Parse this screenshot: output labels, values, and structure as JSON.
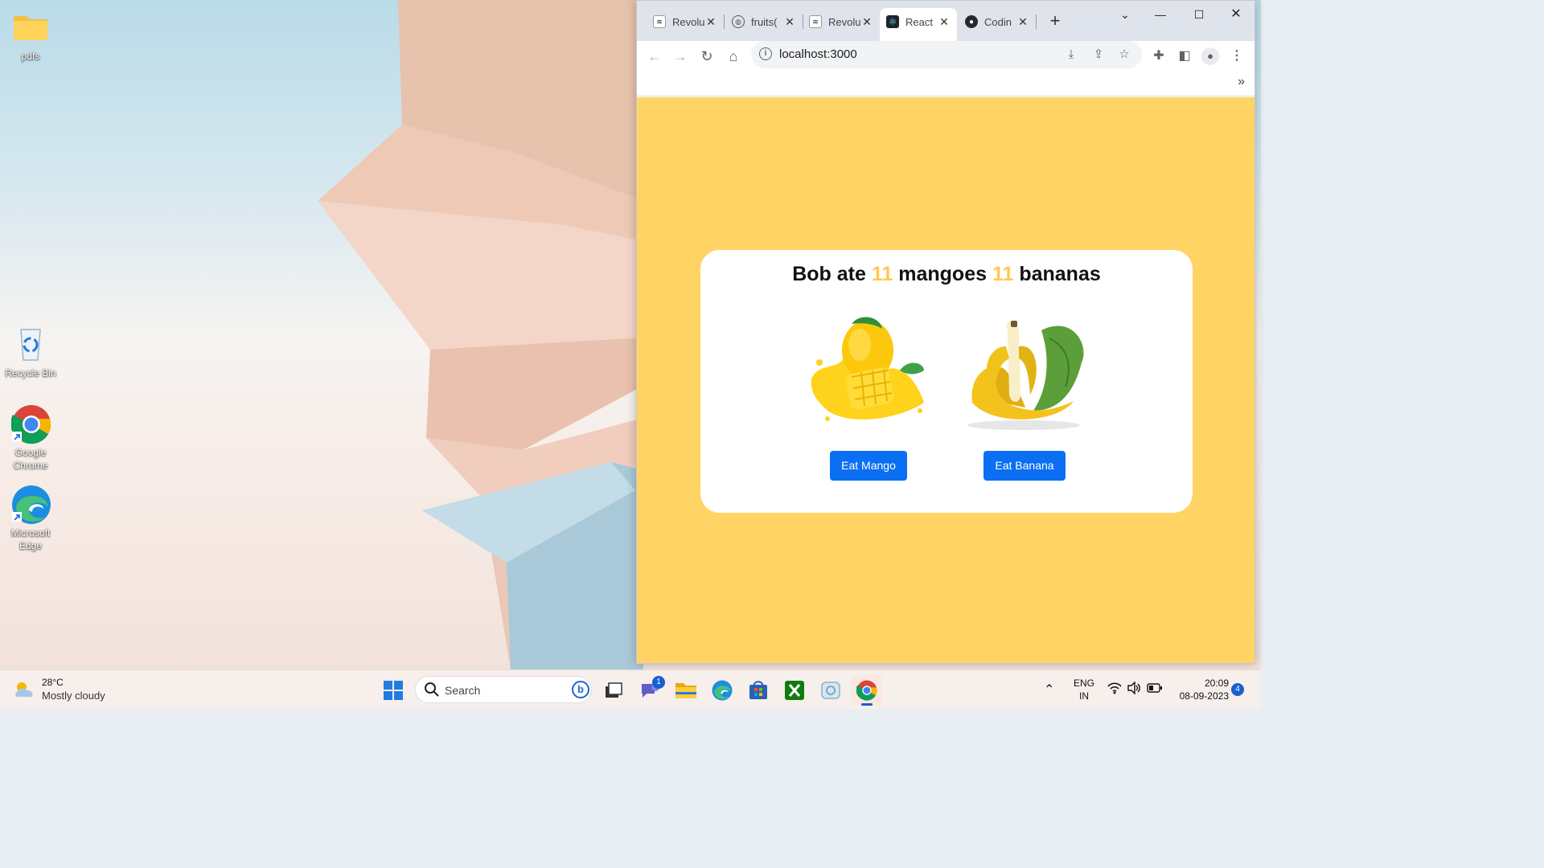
{
  "desktop": {
    "icons": [
      {
        "label": "pdfs",
        "icon": "folder-icon"
      },
      {
        "label": "Recycle Bin",
        "icon": "recycle-bin-icon"
      },
      {
        "label": "Google Chrome",
        "icon": "chrome-icon"
      },
      {
        "label": "Microsoft Edge",
        "icon": "edge-icon"
      }
    ]
  },
  "browser": {
    "tabs": [
      {
        "title": "Revolu",
        "icon": "nxt-wave-icon",
        "active": false
      },
      {
        "title": "fruits(",
        "icon": "globe-icon",
        "active": false
      },
      {
        "title": "Revolu",
        "icon": "nxt-wave-icon",
        "active": false
      },
      {
        "title": "React",
        "icon": "react-icon",
        "active": true
      },
      {
        "title": "Codin",
        "icon": "github-icon",
        "active": false
      }
    ],
    "address": "localhost:3000",
    "overflow_chevron": "»"
  },
  "app": {
    "headline": {
      "prefix": "Bob ate ",
      "mango_count": "11",
      "mid": " mangoes ",
      "banana_count": "11",
      "suffix": " bananas"
    },
    "buttons": {
      "eat_mango": "Eat Mango",
      "eat_banana": "Eat Banana"
    },
    "colors": {
      "background": "#ffd465",
      "accent_number": "#ffc94d",
      "button": "#0a6ff2"
    }
  },
  "taskbar": {
    "weather": {
      "temp": "28°C",
      "condition": "Mostly cloudy"
    },
    "search_placeholder": "Search",
    "teams_badge": "1",
    "language": {
      "line1": "ENG",
      "line2": "IN"
    },
    "clock": {
      "time": "20:09",
      "date": "08-09-2023"
    },
    "notifications": "4"
  }
}
